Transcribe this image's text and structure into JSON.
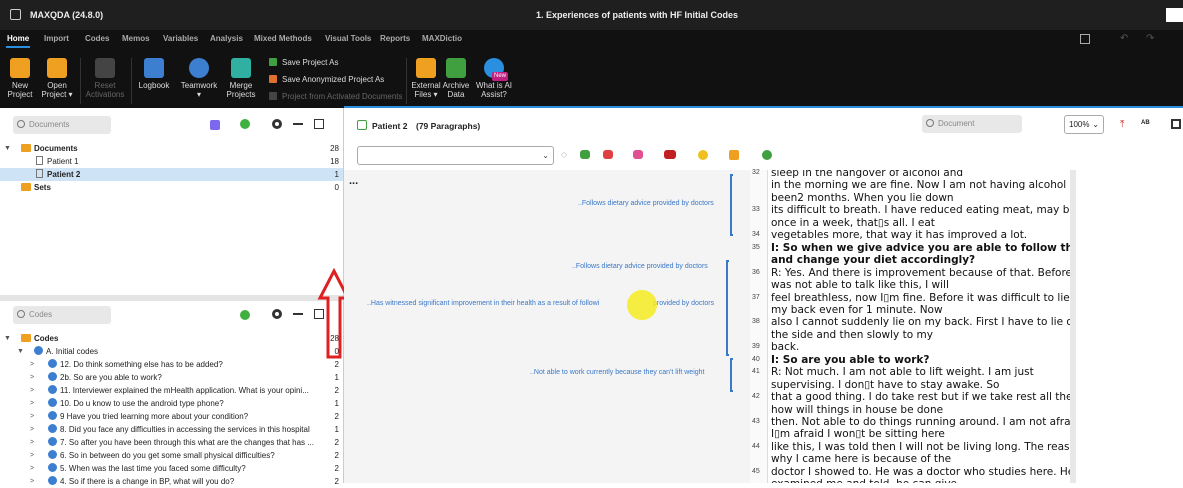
{
  "window": {
    "app_title": "MAXQDA (24.8.0)",
    "doc_title": "1. Experiences of patients with HF Initial Codes"
  },
  "menu": [
    "Home",
    "Import",
    "Codes",
    "Memos",
    "Variables",
    "Analysis",
    "Mixed Methods",
    "Visual Tools",
    "Reports",
    "MAXDictio"
  ],
  "ribbon": {
    "new_project": [
      "New",
      "Project"
    ],
    "open_project": [
      "Open",
      "Project ▾"
    ],
    "reset_activations": [
      "Reset",
      "Activations"
    ],
    "logbook": "Logbook",
    "teamwork": [
      "Teamwork",
      "▾"
    ],
    "merge_projects": [
      "Merge",
      "Projects"
    ],
    "save_as": "Save Project As",
    "save_anon": "Save Anonymized Project As",
    "from_activated": "Project from Activated Documents",
    "external_files": [
      "External",
      "Files ▾"
    ],
    "archive_data": [
      "Archive",
      "Data"
    ],
    "ai_assist": [
      "What is AI",
      "Assist?"
    ],
    "new_badge": "New"
  },
  "colors": {
    "accent": "#2b8fe0",
    "code_blue": "#3c7fd0",
    "folder": "#f0a020",
    "arrow": "#e02020"
  },
  "documents_pane": {
    "search_placeholder": "Documents",
    "root": {
      "label": "Documents",
      "count": "28"
    },
    "items": [
      {
        "label": "Patient 1",
        "count": "18"
      },
      {
        "label": "Patient 2",
        "count": "1"
      }
    ],
    "sets": {
      "label": "Sets",
      "count": "0"
    }
  },
  "codes_pane": {
    "search_placeholder": "Codes",
    "root": {
      "label": "Codes",
      "count": "28"
    },
    "group": {
      "label": "A. Initial codes",
      "count": "0"
    },
    "items": [
      {
        "label": "12. Do think something else has to be added?",
        "count": "2"
      },
      {
        "label": "2b. So are you able to work?",
        "count": "1"
      },
      {
        "label": "11. Interviewer explained the mHealth application.  What is your opini...",
        "count": "2"
      },
      {
        "label": "10. Do u know to use the android type phone?",
        "count": "1"
      },
      {
        "label": "9 Have you tried learning more about your condition?",
        "count": "2"
      },
      {
        "label": "8. Did you face any difficulties in accessing the services in this hospital",
        "count": "1"
      },
      {
        "label": "7. So after you have been through this what are the changes that has ...",
        "count": "2"
      },
      {
        "label": "6. So in between do you get some small physical difficulties?",
        "count": "2"
      },
      {
        "label": "5.  When was the last time you faced some difficulty?",
        "count": "2"
      },
      {
        "label": "4. So if there is a change in BP, what will you do?",
        "count": "2"
      }
    ]
  },
  "doc_view": {
    "title": "Patient 2",
    "paragraphs": "(79 Paragraphs)",
    "search_placeholder": "Document",
    "zoom": "100%",
    "ellipsis": "..."
  },
  "memo_labels": [
    "..Follows dietary advice provided by doctors",
    "..Follows dietary advice provided by doctors",
    "..Has witnessed significant improvement in their health as a result of followi",
    "provided by doctors",
    "..Not able to work currently because they can't lift weight"
  ],
  "text_lines": [
    {
      "ln": "32",
      "text": "sleep in the hangover of alcohol and",
      "bold": false
    },
    {
      "ln": "",
      "text": "in the morning we are fine. Now I am not having alcohol its",
      "bold": false
    },
    {
      "ln": "",
      "text": "been2 months. When you lie down",
      "bold": false
    },
    {
      "ln": "33",
      "text": "its difficult to breath. I have reduced eating meat, may be",
      "bold": false
    },
    {
      "ln": "",
      "text": "once in a week, that▯s all. I eat",
      "bold": false
    },
    {
      "ln": "34",
      "text": "vegetables more, that way it has improved a lot.",
      "bold": false
    },
    {
      "ln": "35",
      "text": "I: So when we give advice you are able to follow that",
      "bold": true
    },
    {
      "ln": "",
      "text": "and change your diet accordingly?",
      "bold": true
    },
    {
      "ln": "36",
      "text": "R: Yes. And there is improvement because of that. Before I",
      "bold": false
    },
    {
      "ln": "",
      "text": "was not able to talk like this, I will",
      "bold": false
    },
    {
      "ln": "37",
      "text": "feel breathless, now I▯m fine. Before it was difficult to lie on",
      "bold": false
    },
    {
      "ln": "",
      "text": "my back even for 1 minute. Now",
      "bold": false
    },
    {
      "ln": "38",
      "text": "also I cannot suddenly lie on my back. First I have to lie on",
      "bold": false
    },
    {
      "ln": "",
      "text": "the side and then slowly to my",
      "bold": false
    },
    {
      "ln": "39",
      "text": "back.",
      "bold": false
    },
    {
      "ln": "40",
      "text": "I: So are you able to work?",
      "bold": true
    },
    {
      "ln": "41",
      "text": "R: Not much. I am not able to lift weight. I am just",
      "bold": false
    },
    {
      "ln": "",
      "text": "supervising. I don▯t have to stay awake. So",
      "bold": false
    },
    {
      "ln": "42",
      "text": "that a good thing. I do take rest but if we take rest all the time",
      "bold": false
    },
    {
      "ln": "",
      "text": "how will things in house be done",
      "bold": false
    },
    {
      "ln": "43",
      "text": "then. Not able to do things running around. I am not afraid, if",
      "bold": false
    },
    {
      "ln": "",
      "text": "I▯m afraid I won▯t be sitting here",
      "bold": false
    },
    {
      "ln": "44",
      "text": "like this, I was told then I will not be living long. The reason",
      "bold": false
    },
    {
      "ln": "",
      "text": "why I came here is because of the",
      "bold": false
    },
    {
      "ln": "45",
      "text": "doctor I showed to. He was a doctor who studies here. He",
      "bold": false
    },
    {
      "ln": "",
      "text": "examined me and told, he can give",
      "bold": false
    }
  ]
}
